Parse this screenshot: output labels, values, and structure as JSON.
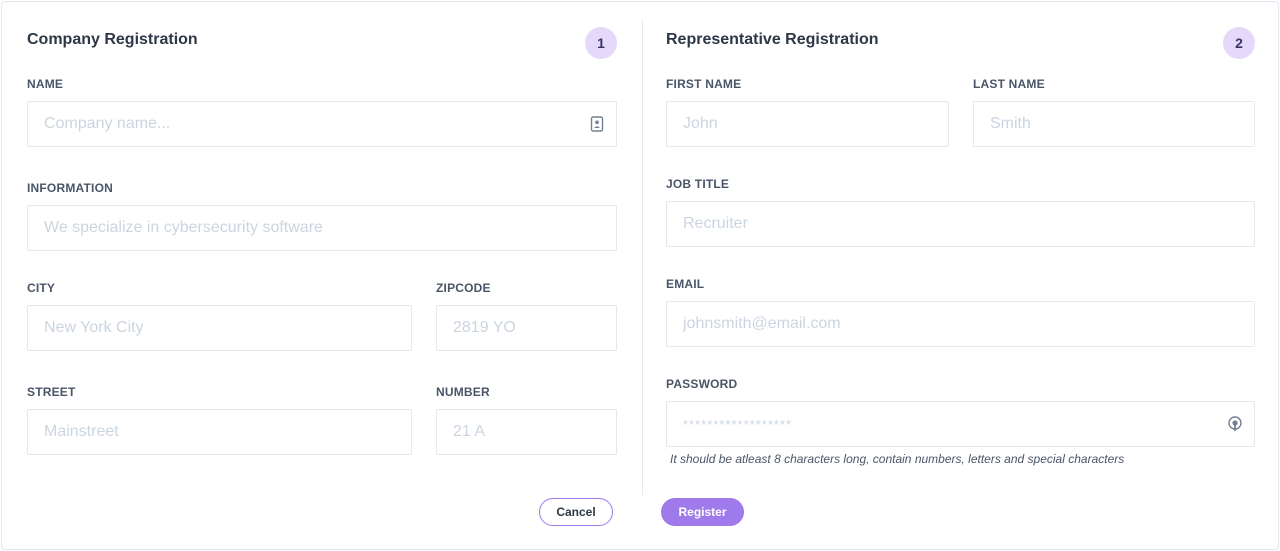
{
  "company": {
    "title": "Company Registration",
    "step": "1",
    "name": {
      "label": "NAME",
      "placeholder": "Company name..."
    },
    "information": {
      "label": "INFORMATION",
      "placeholder": "We specialize in cybersecurity software"
    },
    "city": {
      "label": "CITY",
      "placeholder": "New York City"
    },
    "zipcode": {
      "label": "ZIPCODE",
      "placeholder": "2819 YO"
    },
    "street": {
      "label": "STREET",
      "placeholder": "Mainstreet"
    },
    "number": {
      "label": "NUMBER",
      "placeholder": "21 A"
    }
  },
  "representative": {
    "title": "Representative Registration",
    "step": "2",
    "first_name": {
      "label": "FIRST NAME",
      "placeholder": "John"
    },
    "last_name": {
      "label": "LAST NAME",
      "placeholder": "Smith"
    },
    "job_title": {
      "label": "JOB TITLE",
      "placeholder": "Recruiter"
    },
    "email": {
      "label": "EMAIL",
      "placeholder": "johnsmith@email.com"
    },
    "password": {
      "label": "PASSWORD",
      "placeholder": "******************",
      "hint": "It should be atleast 8 characters long, contain numbers, letters and special characters"
    }
  },
  "actions": {
    "cancel_label": "Cancel",
    "register_label": "Register"
  },
  "icons": {
    "name_field": "contact-card-icon",
    "password_field": "lock-icon"
  },
  "colors": {
    "accent": "#9f7aea",
    "badge_bg": "#e4d9fb",
    "border": "#e2e8f0"
  }
}
